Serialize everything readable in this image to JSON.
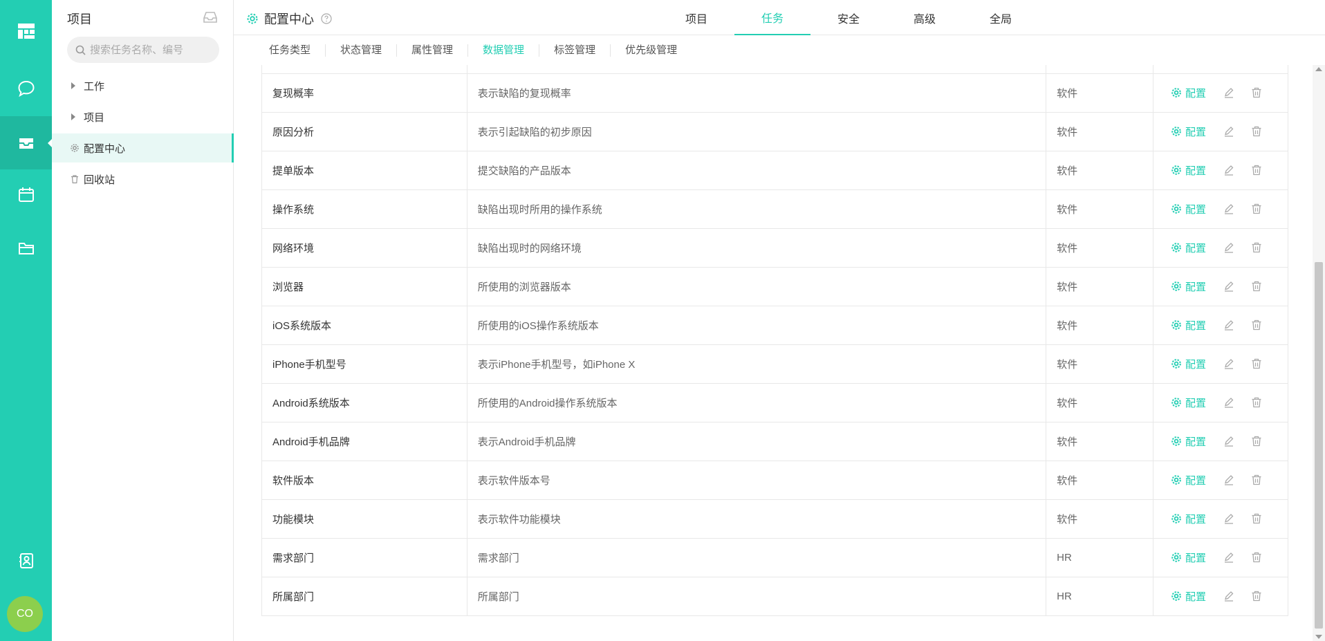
{
  "rail": {
    "avatar_text": "CO",
    "accent_color": "#23ceb3"
  },
  "sidebar": {
    "title": "项目",
    "search_placeholder": "搜索任务名称、编号",
    "items": [
      {
        "label": "工作",
        "icon": "caret-right-icon"
      },
      {
        "label": "项目",
        "icon": "caret-right-icon"
      },
      {
        "label": "配置中心",
        "icon": "gear-icon",
        "active": true
      },
      {
        "label": "回收站",
        "icon": "trash-icon"
      }
    ]
  },
  "header": {
    "title": "配置中心",
    "tabs": [
      "项目",
      "任务",
      "安全",
      "高级",
      "全局"
    ],
    "active_tab": "任务"
  },
  "subtabs": {
    "items": [
      "任务类型",
      "状态管理",
      "属性管理",
      "数据管理",
      "标签管理",
      "优先级管理"
    ],
    "active": "数据管理"
  },
  "table": {
    "config_label": "配置",
    "rows": [
      {
        "name": "复现概率",
        "desc": "表示缺陷的复现概率",
        "category": "软件"
      },
      {
        "name": "原因分析",
        "desc": "表示引起缺陷的初步原因",
        "category": "软件"
      },
      {
        "name": "提单版本",
        "desc": "提交缺陷的产品版本",
        "category": "软件"
      },
      {
        "name": "操作系统",
        "desc": "缺陷出现时所用的操作系统",
        "category": "软件"
      },
      {
        "name": "网络环境",
        "desc": "缺陷出现时的网络环境",
        "category": "软件"
      },
      {
        "name": "浏览器",
        "desc": "所使用的浏览器版本",
        "category": "软件"
      },
      {
        "name": "iOS系统版本",
        "desc": "所使用的iOS操作系统版本",
        "category": "软件"
      },
      {
        "name": "iPhone手机型号",
        "desc": "表示iPhone手机型号，如iPhone X",
        "category": "软件"
      },
      {
        "name": "Android系统版本",
        "desc": "所使用的Android操作系统版本",
        "category": "软件"
      },
      {
        "name": "Android手机品牌",
        "desc": "表示Android手机品牌",
        "category": "软件"
      },
      {
        "name": "软件版本",
        "desc": "表示软件版本号",
        "category": "软件"
      },
      {
        "name": "功能模块",
        "desc": "表示软件功能模块",
        "category": "软件"
      },
      {
        "name": "需求部门",
        "desc": "需求部门",
        "category": "HR"
      },
      {
        "name": "所属部门",
        "desc": "所属部门",
        "category": "HR"
      }
    ]
  }
}
